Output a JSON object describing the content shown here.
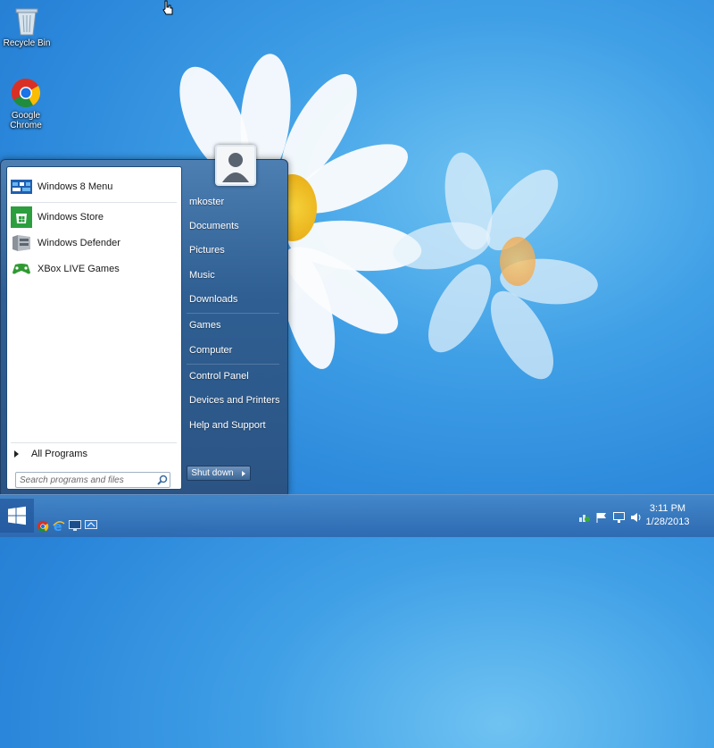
{
  "desktop": {
    "icons": [
      {
        "label": "Recycle Bin"
      },
      {
        "label": "Google Chrome"
      }
    ]
  },
  "start_menu": {
    "pinned": [
      {
        "label": "Windows 8 Menu",
        "icon": "windows8-menu-icon"
      },
      {
        "label": "Windows Store",
        "icon": "store-icon"
      },
      {
        "label": "Windows Defender",
        "icon": "defender-icon"
      },
      {
        "label": "XBox LIVE Games",
        "icon": "xbox-icon"
      }
    ],
    "all_programs": "All Programs",
    "search_placeholder": "Search programs and files",
    "user": "mkoster",
    "right_items": [
      {
        "label": "mkoster"
      },
      {
        "label": "Documents"
      },
      {
        "label": "Pictures"
      },
      {
        "label": "Music"
      },
      {
        "label": "Downloads"
      },
      {
        "label": "Games"
      },
      {
        "label": "Computer"
      },
      {
        "label": "Control Panel"
      },
      {
        "label": "Devices and Printers"
      },
      {
        "label": "Help and Support"
      }
    ],
    "shutdown_label": "Shut down"
  },
  "taskbar": {
    "clock": {
      "time": "3:11 PM",
      "date": "1/28/2013"
    },
    "pinned_icons": [
      "chrome-icon",
      "ie-icon",
      "monitor-icon",
      "remote-desktop-icon"
    ],
    "tray_icons": [
      "network-icon",
      "flag-icon",
      "display-icon",
      "volume-icon"
    ]
  },
  "colors": {
    "accent": "#2b5484",
    "desktop": "#3f9fe6"
  }
}
